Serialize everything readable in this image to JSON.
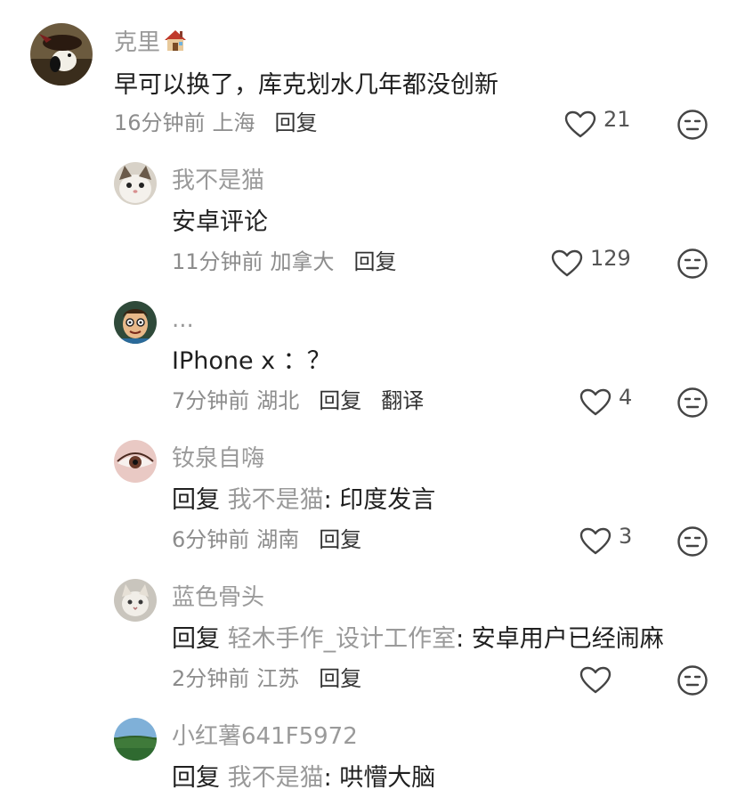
{
  "comments": [
    {
      "username": "克里",
      "text": "早可以换了，库克划水几年都没创新",
      "time": "16分钟前",
      "location": "上海",
      "reply_label": "回复",
      "likes": "21"
    },
    {
      "username": "我不是猫",
      "text": "安卓评论",
      "time": "11分钟前",
      "location": "加拿大",
      "reply_label": "回复",
      "likes": "129"
    },
    {
      "username": "...",
      "text": "IPhone x ：？",
      "time": "7分钟前",
      "location": "湖北",
      "reply_label": "回复",
      "translate_label": "翻译",
      "likes": "4"
    },
    {
      "username": "钕泉自嗨",
      "reply_word": "回复",
      "reply_target": "我不是猫",
      "text": ": 印度发言",
      "time": "6分钟前",
      "location": "湖南",
      "reply_label": "回复",
      "likes": "3"
    },
    {
      "username": "蓝色骨头",
      "reply_word": "回复",
      "reply_target": "轻木手作_设计工作室",
      "text": ": 安卓用户已经闹麻",
      "time": "2分钟前",
      "location": "江苏",
      "reply_label": "回复",
      "likes": ""
    },
    {
      "username": "小红薯641F5972",
      "reply_word": "回复",
      "reply_target": "我不是猫",
      "text": ": 哄懵大脑"
    }
  ],
  "icons": {
    "like": "heart-outline-icon",
    "dislike": "neutral-face-icon",
    "badge": "house-emoji-icon"
  },
  "colors": {
    "username": "#9a9a9a",
    "text": "#1f1f1f",
    "meta": "#8c8c8c",
    "action": "#333333"
  }
}
